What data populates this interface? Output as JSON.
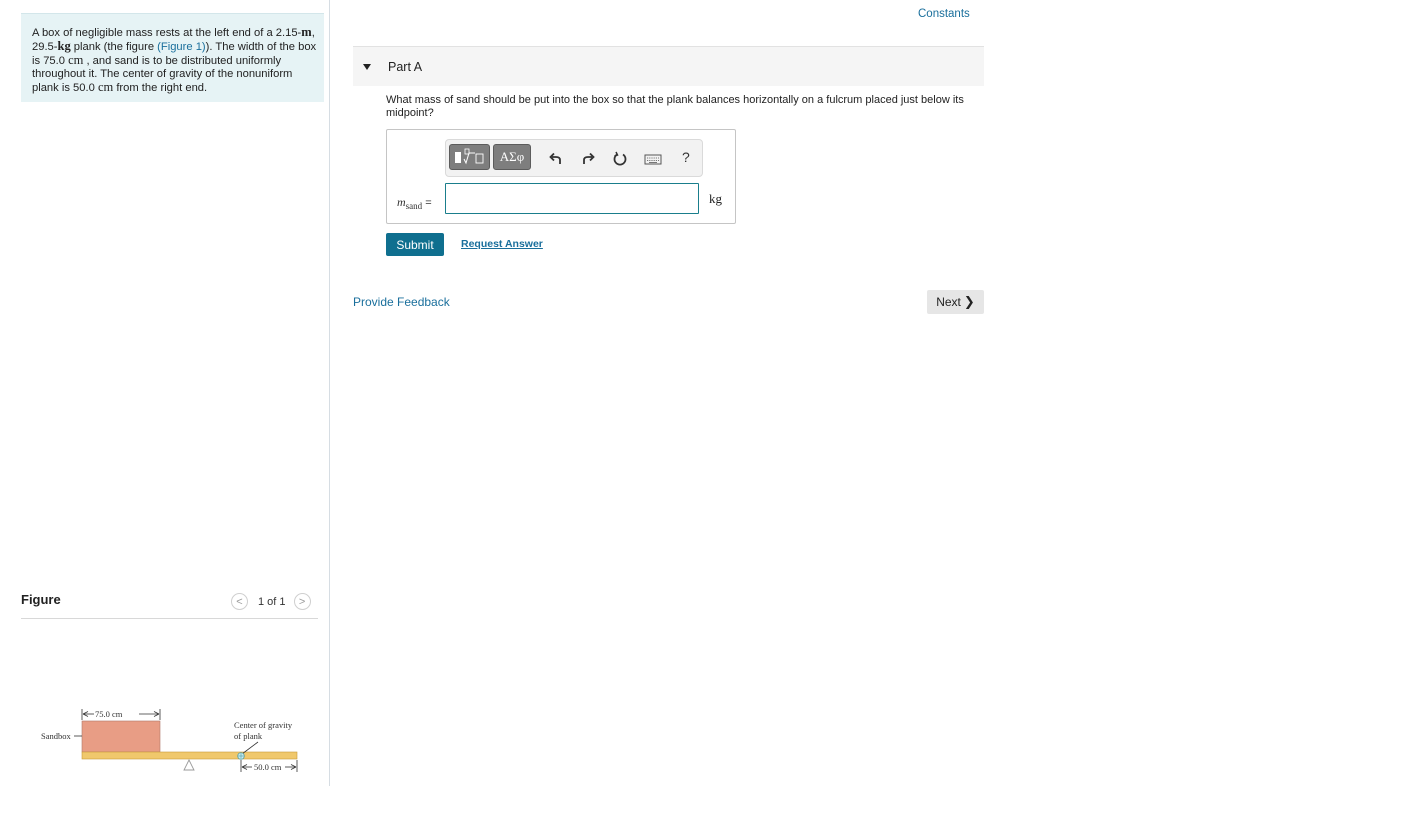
{
  "problem": {
    "t1": "A box of negligible mass rests at the left end of a 2.15-",
    "u1": "m",
    "t2": ", 29.5-",
    "u2": "kg",
    "t3": " plank (the figure ",
    "figure_link": "(Figure 1)",
    "t4": "). The width of the box is 75.0 ",
    "u3": "cm",
    "t5": " , and sand is to be distributed uniformly throughout it. The center of gravity of the nonuniform plank is 50.0 ",
    "u4": "cm",
    "t6": " from the right end."
  },
  "figure": {
    "title": "Figure",
    "pager_prev": "<",
    "pager_text": "1 of 1",
    "pager_next": ">",
    "labels": {
      "box_width": "75.0 cm",
      "sandbox": "Sandbox",
      "cog_line1": "Center of gravity",
      "cog_line2": "of plank",
      "cog_dist": "50.0 cm"
    }
  },
  "header": {
    "constants_link": "Constants"
  },
  "part": {
    "label": "Part A",
    "question": "What mass of sand should be put into the box so that the plank balances horizontally on a fulcrum placed just below its midpoint?"
  },
  "answer": {
    "toolbar": {
      "template_icon": "template-icon",
      "symbols_label": "ΑΣφ",
      "help": "?"
    },
    "variable": "m",
    "variable_sub": "sand",
    "equals": "=",
    "value": "",
    "unit": "kg"
  },
  "actions": {
    "submit": "Submit",
    "request_answer": "Request Answer",
    "provide_feedback": "Provide Feedback",
    "next": "Next",
    "next_chevron": "❯"
  },
  "colors": {
    "accent": "#0f6f8f",
    "link": "#1a6f9c",
    "problem_bg": "#e6f3f5",
    "box_fill": "#e89d85",
    "plank_fill": "#f0c86c"
  }
}
